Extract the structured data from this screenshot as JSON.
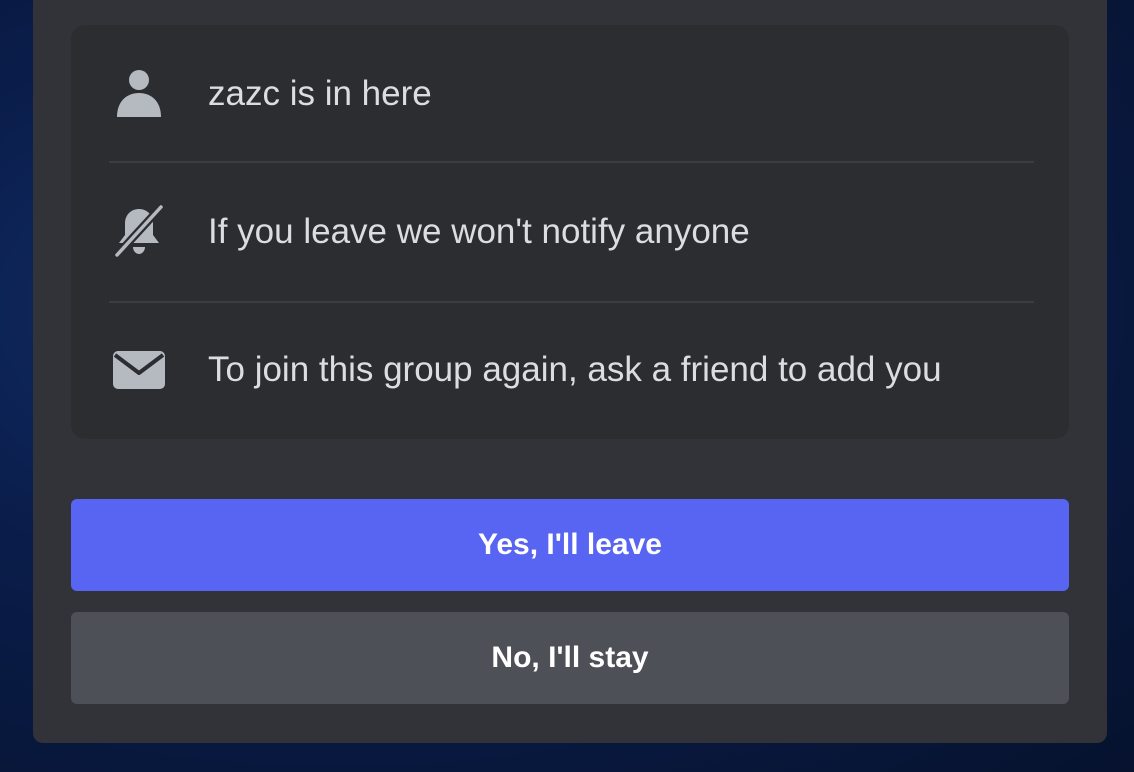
{
  "modal": {
    "info_rows": [
      {
        "icon": "person-icon",
        "text": "zazc is in here"
      },
      {
        "icon": "bell-off-icon",
        "text": "If you leave we won't notify anyone"
      },
      {
        "icon": "envelope-icon",
        "text": "To join this group again, ask a friend to add you"
      }
    ],
    "buttons": {
      "confirm_label": "Yes, I'll leave",
      "cancel_label": "No, I'll stay"
    }
  },
  "colors": {
    "primary_button": "#5865f2",
    "secondary_button": "#4e5058",
    "modal_background": "#313338",
    "card_background": "#2b2d31",
    "icon_color": "#b5bac1",
    "text_color": "#dbdee1"
  }
}
